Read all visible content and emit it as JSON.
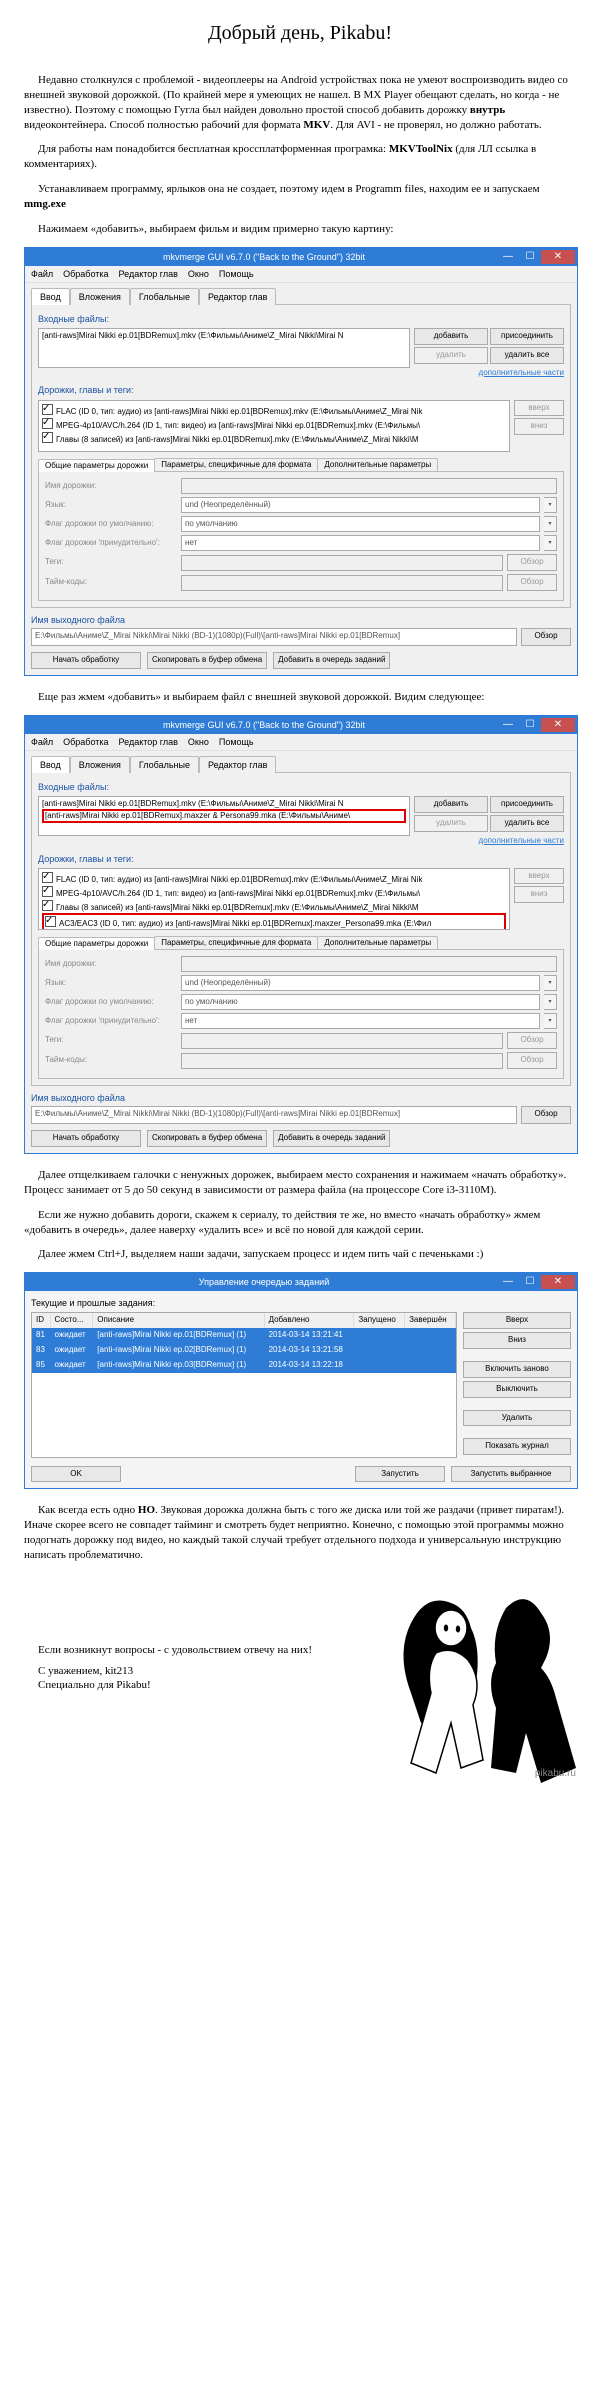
{
  "title": "Добрый день, Pikabu!",
  "paragraphs": {
    "p1a": "Недавно столкнулся с проблемой - видеоплееры на Android устройствах пока не умеют воспроизводить видео со внешней звуковой дорожкой. (По крайней мере я умеющих не нашел. В MX Player обещают сделать, но когда - не известно). Поэтому с помощью Гугла был найден довольно простой способ добавить дорожку ",
    "p1b": "внутрь",
    "p1c": " видеоконтейнера. Способ полностью рабочий для формата ",
    "p1d": "MKV",
    "p1e": ". Для AVI - не проверял, но должно работать.",
    "p2a": "Для работы нам понадобится бесплатная кроссплатформенная програмка: ",
    "p2b": "MKVToolNix",
    "p2c": " (для ЛЛ ссылка в комментариях).",
    "p3a": "Устанавливаем программу, ярлыков она не создает, поэтому идем в Programm files, находим ее и запускаем ",
    "p3b": "mmg.exe",
    "p4": "Нажимаем «добавить», выбираем фильм и видим примерно такую картину:",
    "p5": "Еще раз жмем «добавить» и выбираем файл с внешней звуковой дорожкой. Видим следующее:",
    "p6": "Далее отщелкиваем галочки с ненужных дорожек, выбираем место сохранения и нажимаем «начать обработку». Процесс занимает от 5 до 50 секунд в зависимости от размера файла (на процессоре Core i3-3110M).",
    "p7": "Если же нужно добавить дороги, скажем к сериалу, то действия те же, но вместо «начать обработку» жмем «добавить в очередь», далее наверху «удалить все» и всё по новой для каждой серии.",
    "p8": "Далее жмем Ctrl+J, выделяем наши задачи, запускаем процесс и идем пить чай с печеньками :)",
    "p9a": "Как всегда есть одно ",
    "p9b": "НО",
    "p9c": ". Звуковая дорожка должна быть с того же диска или той же раздачи (привет пиратам!). Иначе скорее всего не совпадет тайминг и смотреть будет неприятно. Конечно, с помощью этой программы можно подогнать дорожку под видео, но каждый такой случай требует отдельного подхода и универсальную инструкцию написать проблематично.",
    "p10": "Если возникнут вопросы - с удовольствием отвечу на них!",
    "sig1": "С уважением, kit213",
    "sig2": "Специально для Pikabu!"
  },
  "win": {
    "title": "mkvmerge GUI v6.7.0 (\"Back to the Ground\") 32bit",
    "menu": [
      "Файл",
      "Обработка",
      "Редактор глав",
      "Окно",
      "Помощь"
    ],
    "tabs": [
      "Ввод",
      "Вложения",
      "Глобальные",
      "Редактор глав"
    ],
    "labels": {
      "input_files": "Входные файлы:",
      "btn_add": "добавить",
      "btn_append": "присоединить",
      "btn_remove": "удалить",
      "btn_remove_all": "удалить все",
      "link_parts": "дополнительные части",
      "tracks_label": "Дорожки, главы и теги:",
      "btn_up": "вверх",
      "btn_down": "вниз",
      "subtab1": "Общие параметры дорожки",
      "subtab2": "Параметры, специфичные для формата",
      "subtab3": "Дополнительные параметры",
      "f_name": "Имя дорожки:",
      "f_lang": "Язык:",
      "f_lang_val": "und (Неопределённый)",
      "f_default": "Флаг дорожки по умолчанию:",
      "f_default_val": "по умолчанию",
      "f_forced": "Флаг дорожки 'принудительно':",
      "f_forced_val": "нет",
      "f_tags": "Теги:",
      "f_tc": "Тайм-коды:",
      "btn_browse": "Обзор",
      "out_label": "Имя выходного файла",
      "out_path": "E:\\Фильмы\\Аниме\\Z_Mirai Nikki\\Mirai Nikki (BD-1)(1080p)(Full)\\[anti-raws]Mirai Nikki ep.01[BDRemux]",
      "btn_start": "Начать обработку",
      "btn_copy": "Скопировать в буфер обмена",
      "btn_queue": "Добавить в очередь заданий"
    },
    "files1": [
      "[anti-raws]Mirai Nikki ep.01[BDRemux].mkv (E:\\Фильмы\\Аниме\\Z_Mirai Nikki\\Mirai N"
    ],
    "files2": [
      "[anti-raws]Mirai Nikki ep.01[BDRemux].mkv (E:\\Фильмы\\Аниме\\Z_Mirai Nikki\\Mirai N",
      "[anti-raws]Mirai Nikki ep.01[BDRemux].maxzer & Persona99.mka (E:\\Фильмы\\Аниме\\"
    ],
    "tracks1": [
      "FLAC (ID 0, тип: аудио) из [anti-raws]Mirai Nikki ep.01[BDRemux].mkv (E:\\Фильмы\\Аниме\\Z_Mirai Nik",
      "MPEG-4p10/AVC/h.264 (ID 1, тип: видео) из [anti-raws]Mirai Nikki ep.01[BDRemux].mkv (E:\\Фильмы\\",
      "Главы (8 записей) из [anti-raws]Mirai Nikki ep.01[BDRemux].mkv (E:\\Фильмы\\Аниме\\Z_Mirai Nikki\\M"
    ],
    "tracks2": [
      "FLAC (ID 0, тип: аудио) из [anti-raws]Mirai Nikki ep.01[BDRemux].mkv (E:\\Фильмы\\Аниме\\Z_Mirai Nik",
      "MPEG-4p10/AVC/h.264 (ID 1, тип: видео) из [anti-raws]Mirai Nikki ep.01[BDRemux].mkv (E:\\Фильмы\\",
      "Главы (8 записей) из [anti-raws]Mirai Nikki ep.01[BDRemux].mkv (E:\\Фильмы\\Аниме\\Z_Mirai Nikki\\M",
      "AC3/EAC3 (ID 0, тип: аудио) из [anti-raws]Mirai Nikki ep.01[BDRemux].maxzer_Persona99.mka (E:\\Фил"
    ]
  },
  "jobs": {
    "title": "Управление очередью заданий",
    "group": "Текущие и прошлые задания:",
    "headers": [
      "ID",
      "Состо...",
      "Описание",
      "Добавлено",
      "Запущено",
      "Завершён"
    ],
    "rows": [
      [
        "81",
        "ожидает",
        "[anti-raws]Mirai Nikki ep.01[BDRemux] (1)",
        "2014-03-14 13:21:41",
        "",
        ""
      ],
      [
        "83",
        "ожидает",
        "[anti-raws]Mirai Nikki ep.02[BDRemux] (1)",
        "2014-03-14 13:21:58",
        "",
        ""
      ],
      [
        "85",
        "ожидает",
        "[anti-raws]Mirai Nikki ep.03[BDRemux] (1)",
        "2014-03-14 13:22:18",
        "",
        ""
      ]
    ],
    "btns": {
      "up": "Вверх",
      "down": "Вниз",
      "reenable": "Включить заново",
      "disable": "Выключить",
      "del": "Удалить",
      "log": "Показать журнал",
      "start_sel": "Запустить выбранное",
      "start": "Запустить",
      "ok": "OK"
    }
  },
  "watermark": "pikabu.ru"
}
